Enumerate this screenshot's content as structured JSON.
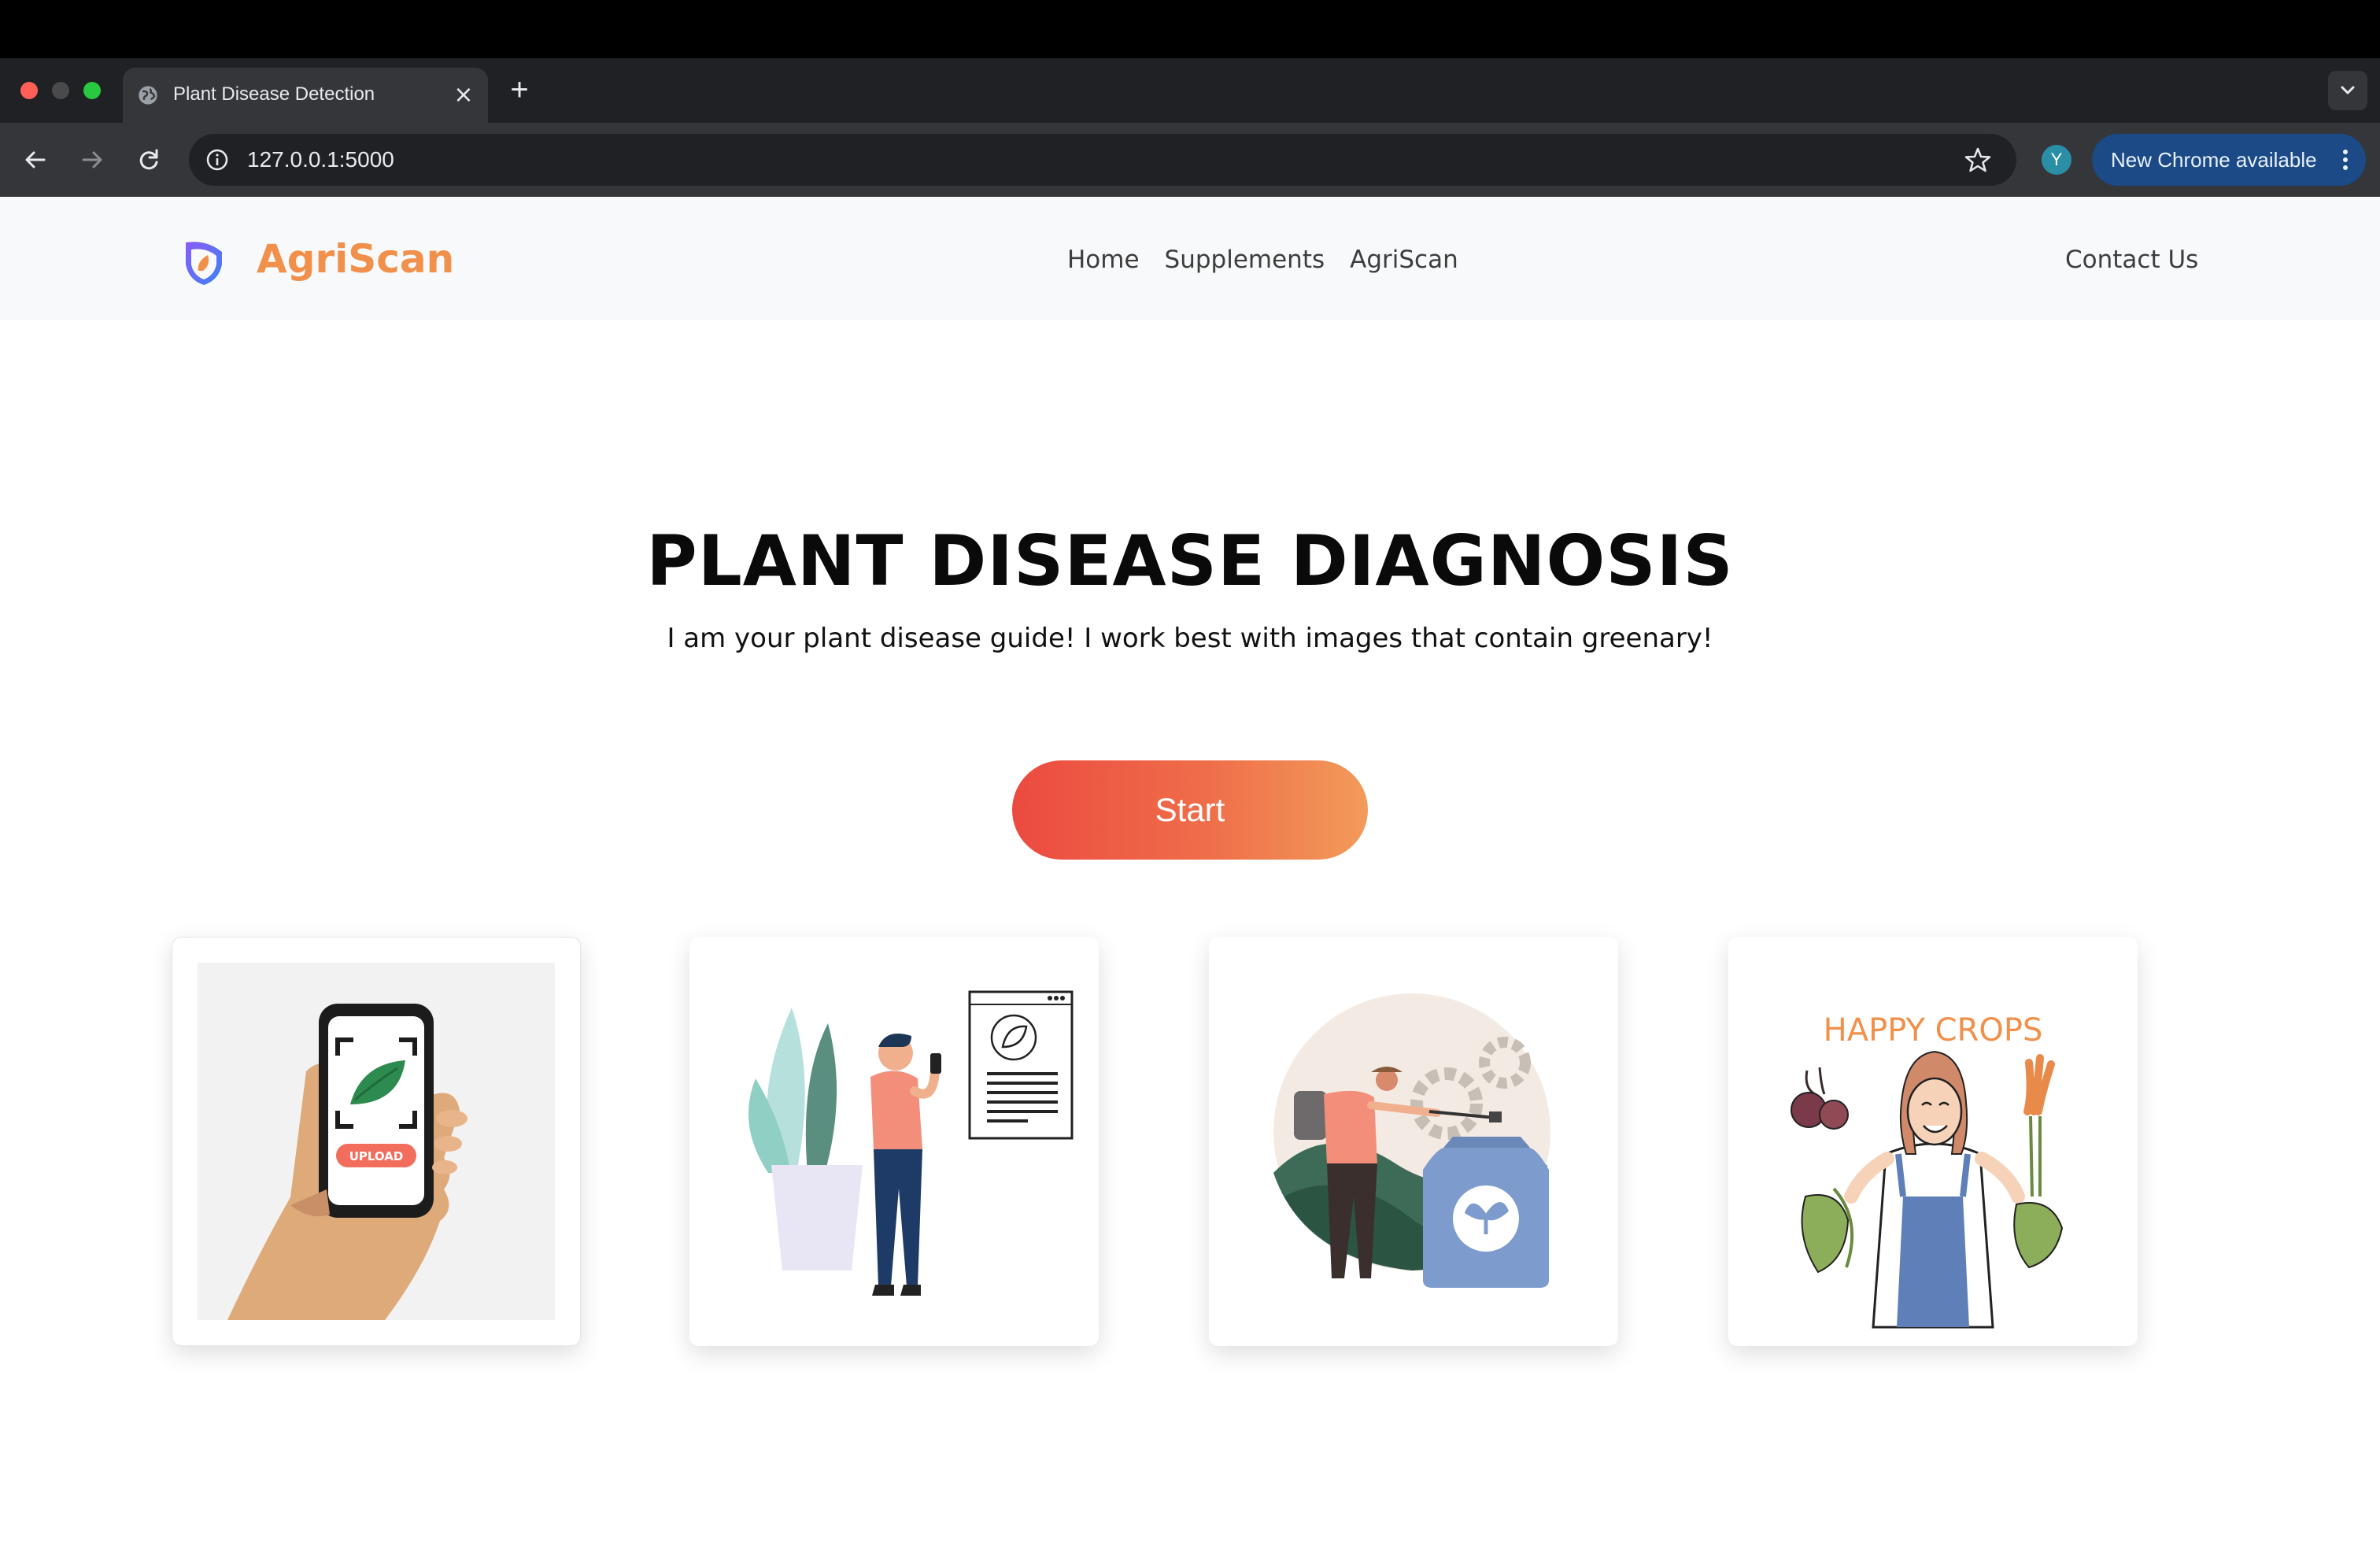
{
  "browser": {
    "tab_title": "Plant Disease Detection",
    "url": "127.0.0.1:5000",
    "profile_initial": "Y",
    "update_label": "New Chrome available"
  },
  "navbar": {
    "brand": "AgriScan",
    "links": [
      "Home",
      "Supplements",
      "AgriScan"
    ],
    "contact": "Contact Us"
  },
  "hero": {
    "title": "PLANT DISEASE DIAGNOSIS",
    "subtitle": "I am your plant disease guide! I work best with images that contain greenary!",
    "start_label": "Start"
  },
  "cards": {
    "upload_label": "UPLOAD",
    "happy_crops": "HAPPY CROPS"
  },
  "colors": {
    "brand_orange": "#f0904a",
    "start_gradient_from": "#ec4a40",
    "start_gradient_to": "#f29b5a",
    "navbar_bg": "#f8f9fa",
    "chrome_update_pill": "#1b4a86"
  }
}
